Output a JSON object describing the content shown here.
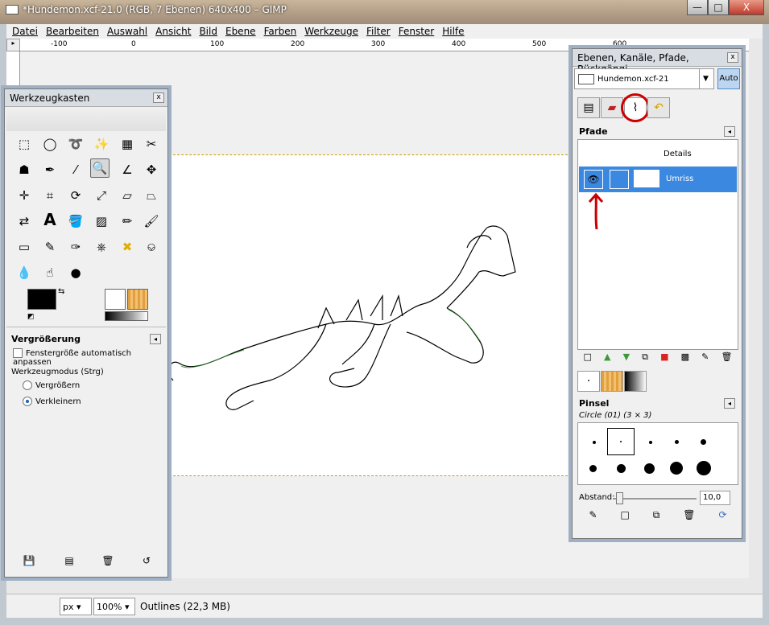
{
  "window": {
    "title": "*Hundemon.xcf-21.0 (RGB, 7 Ebenen) 640x400 – GIMP",
    "min": "—",
    "max": "□",
    "close": "X"
  },
  "menu": [
    "Datei",
    "Bearbeiten",
    "Auswahl",
    "Ansicht",
    "Bild",
    "Ebene",
    "Farben",
    "Werkzeuge",
    "Filter",
    "Fenster",
    "Hilfe"
  ],
  "ruler": {
    "ticks": [
      "-100",
      "0",
      "100",
      "200",
      "300",
      "400",
      "500",
      "600"
    ],
    "corner": "▸"
  },
  "status": {
    "unit": "px",
    "zoom": "100%",
    "info": "Outlines (22,3 MB)"
  },
  "toolbox": {
    "title": "Werkzeugkasten",
    "close": "x",
    "section": "Vergrößerung",
    "option": "Fenstergröße automatisch anpassen",
    "mode_label": "Werkzeugmodus (Strg)",
    "mode_a": "Vergrößern",
    "mode_b": "Verkleinern",
    "mode_selected": "Verkleinern"
  },
  "dock": {
    "title": "Ebenen, Kanäle, Pfade, Rückgängi...",
    "close": "x",
    "image": "Hundemon.xcf-21",
    "auto": "Auto",
    "paths_title": "Pfade",
    "details": "Details",
    "path_name": "Umriss",
    "brushes_title": "Pinsel",
    "brush_name": "Circle (01) (3 × 3)",
    "spacing_label": "Abstand:",
    "spacing_value": "10,0"
  },
  "colors": {
    "accent": "#3a88e0",
    "annotation": "#cc0000"
  }
}
